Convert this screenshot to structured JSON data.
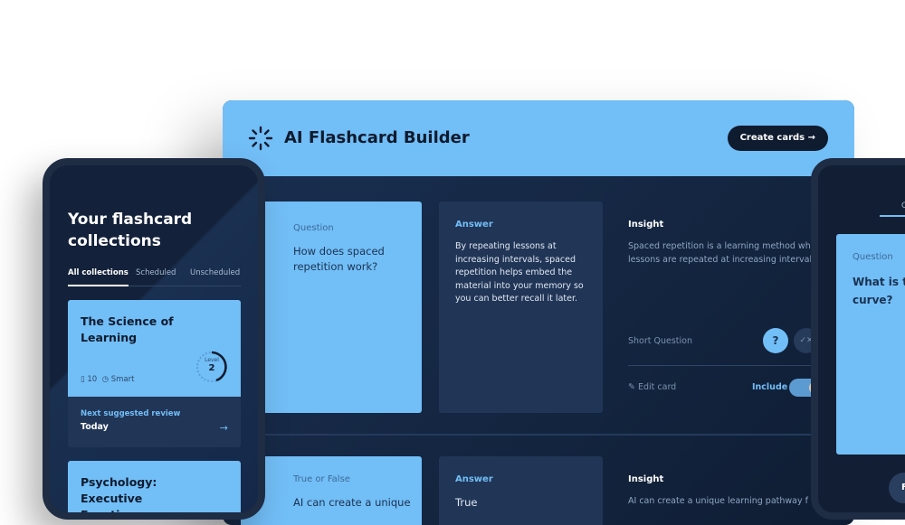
{
  "desktop": {
    "title": "AI Flashcard Builder",
    "create_button": "Create cards →",
    "cards": [
      {
        "question_label": "Question",
        "question": "How does spaced repetition work?",
        "answer_label": "Answer",
        "answer": "By repeating lessons at increasing intervals, spaced repetition helps embed the material into your memory so you can better recall it later.",
        "insight_label": "Insight",
        "insight": "Spaced repetition is a learning method whereby lessons are repeated at increasing intervals.",
        "type": "Short Question",
        "question_icon": "?",
        "edit": "Edit card",
        "include": "Include",
        "include_on": true
      },
      {
        "question_label": "True or False",
        "question": "AI can create a unique",
        "answer_label": "Answer",
        "answer": "True",
        "insight_label": "Insight",
        "insight": "AI can create a unique learning pathway f"
      }
    ]
  },
  "phone": {
    "title": "Your flashcard collections",
    "tabs": [
      "All collections",
      "Scheduled",
      "Unscheduled"
    ],
    "collections": [
      {
        "title": "The Science of Learning",
        "cards": "10",
        "mode": "Smart",
        "level_label": "Level",
        "level": "2",
        "next_label": "Next suggested review",
        "next": "Today"
      },
      {
        "title": "Psychology: Executive Function"
      }
    ]
  },
  "right_phone": {
    "question_label": "Question",
    "question": "What is t",
    "question_line2": "curve?",
    "button": "F"
  },
  "colors": {
    "accent": "#72bef7",
    "dark": "#0f1b2e",
    "panel": "#213556"
  }
}
